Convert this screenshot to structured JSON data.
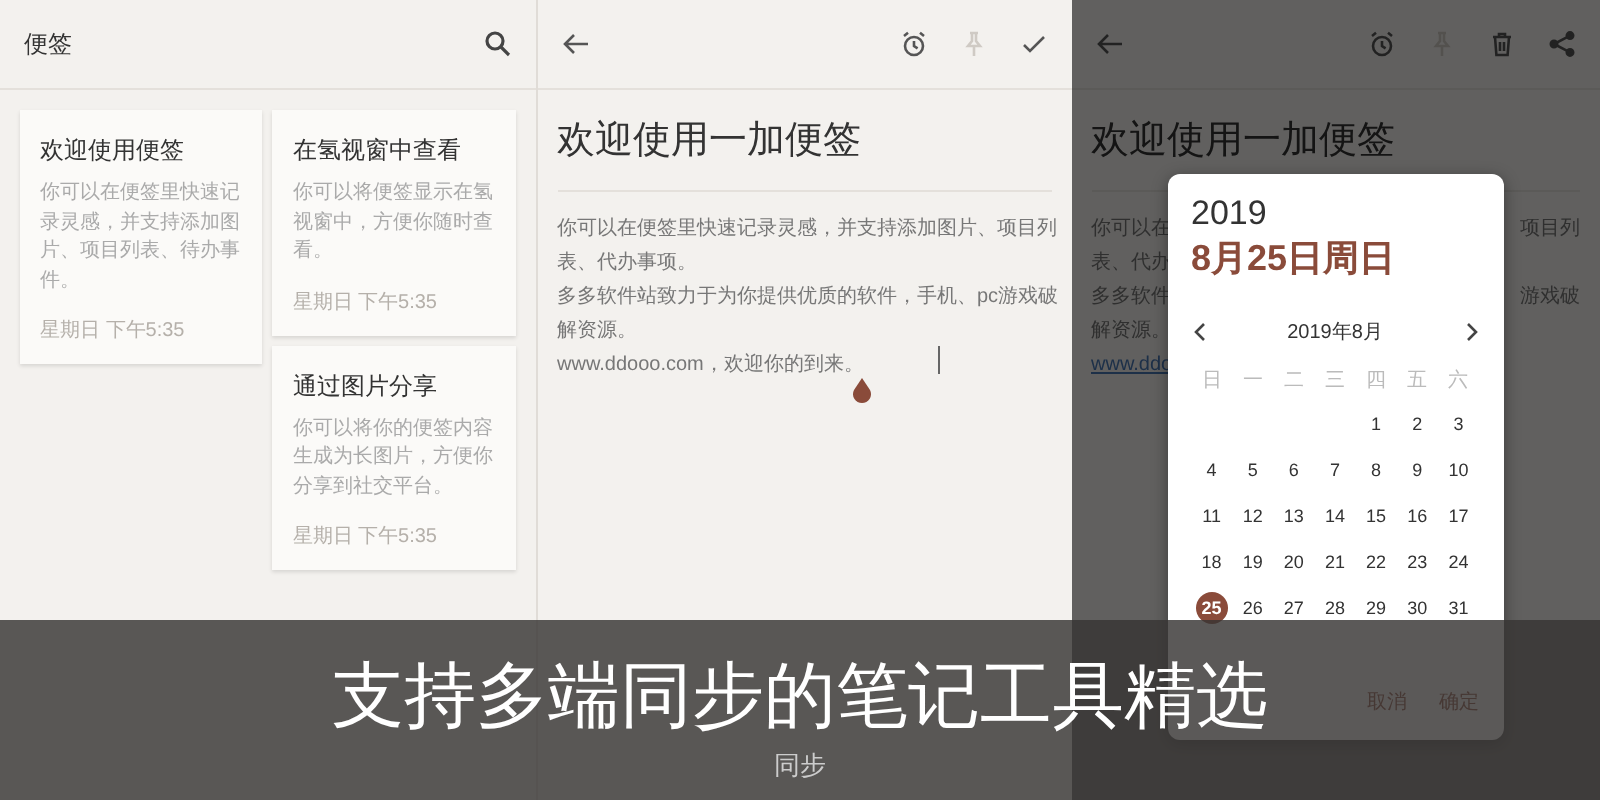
{
  "list_screen": {
    "title": "便签",
    "notes": [
      {
        "title": "欢迎使用便签",
        "body": "你可以在便签里快速记录灵感，并支持添加图片、项目列表、待办事件。",
        "time": "星期日 下午5:35"
      },
      {
        "title": "在氢视窗中查看",
        "body": "你可以将便签显示在氢视窗中，方便你随时查看。",
        "time": "星期日 下午5:35"
      },
      {
        "title": "通过图片分享",
        "body": "你可以将你的便签内容生成为长图片，方便你分享到社交平台。",
        "time": "星期日 下午5:35"
      }
    ]
  },
  "editor_screen": {
    "actions": [
      {
        "kind": "alarm",
        "disabled": false
      },
      {
        "kind": "pin",
        "disabled": true
      },
      {
        "kind": "check",
        "disabled": false
      }
    ],
    "title": "欢迎使用一加便签",
    "lines": [
      "你可以在便签里快速记录灵感，并支持添加图片、项目列",
      "表、代办事项。",
      "多多软件站致力于为你提供优质的软件，手机、pc游戏破",
      "解资源。",
      "www.ddooo.com，欢迎你的到来。"
    ]
  },
  "date_screen": {
    "actions": [
      {
        "kind": "alarm",
        "disabled": false
      },
      {
        "kind": "pin",
        "disabled": true
      },
      {
        "kind": "trash",
        "disabled": false
      },
      {
        "kind": "share",
        "disabled": false
      }
    ],
    "title": "欢迎使用一加便签",
    "lines": [
      {
        "left": "你可以在",
        "right": "项目列"
      },
      {
        "left": "表、代办"
      },
      {
        "left": "多多软件",
        "right": "游戏破"
      },
      {
        "left": "解资源。"
      },
      {
        "left": "www.ddo",
        "kind": "link"
      }
    ],
    "date_dialog": {
      "year": "2019",
      "date": "8月25日周日",
      "month": "2019年8月",
      "weekdays": [
        "日",
        "一",
        "二",
        "三",
        "四",
        "五",
        "六"
      ],
      "weeks": [
        {
          "days": [
            {
              "day": "1",
              "selected": false
            },
            {
              "day": "2",
              "selected": false
            },
            {
              "day": "3",
              "selected": false
            }
          ]
        },
        {
          "days": [
            {
              "day": "4",
              "selected": false
            },
            {
              "day": "5",
              "selected": false
            },
            {
              "day": "6",
              "selected": false
            },
            {
              "day": "7",
              "selected": false
            },
            {
              "day": "8",
              "selected": false
            },
            {
              "day": "9",
              "selected": false
            },
            {
              "day": "10",
              "selected": false
            }
          ]
        },
        {
          "days": [
            {
              "day": "11",
              "selected": false
            },
            {
              "day": "12",
              "selected": false
            },
            {
              "day": "13",
              "selected": false
            },
            {
              "day": "14",
              "selected": false
            },
            {
              "day": "15",
              "selected": false
            },
            {
              "day": "16",
              "selected": false
            },
            {
              "day": "17",
              "selected": false
            }
          ]
        },
        {
          "days": [
            {
              "day": "18",
              "selected": false
            },
            {
              "day": "19",
              "selected": false
            },
            {
              "day": "20",
              "selected": false
            },
            {
              "day": "21",
              "selected": false
            },
            {
              "day": "22",
              "selected": false
            },
            {
              "day": "23",
              "selected": false
            },
            {
              "day": "24",
              "selected": false
            }
          ]
        },
        {
          "days": [
            {
              "day": "25",
              "selected": true
            },
            {
              "day": "26",
              "selected": false
            },
            {
              "day": "27",
              "selected": false
            },
            {
              "day": "28",
              "selected": false
            },
            {
              "day": "29",
              "selected": false
            },
            {
              "day": "30",
              "selected": false
            },
            {
              "day": "31",
              "selected": false
            }
          ]
        }
      ],
      "buttons": [
        "取消",
        "确定"
      ]
    }
  },
  "banner": {
    "title": "支持多端同步的笔记工具精选",
    "subtitle": "同步"
  }
}
